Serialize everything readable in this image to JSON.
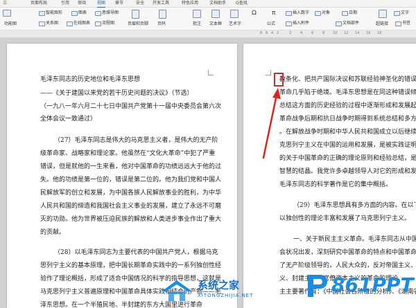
{
  "menu": {
    "tabs": [
      "三",
      "页面布局",
      "引用",
      "审阅",
      "视图",
      "章节",
      "安全",
      "开发工具",
      "特色应用",
      "文档助手",
      "Q查找"
    ],
    "active_index": 4
  },
  "ribbon": {
    "row1": [
      "智能图形",
      "图表",
      "思维导图",
      "插入数字",
      "对象",
      "日期",
      "文字"
    ],
    "row2": [
      "功能图",
      "关系图",
      "在线图表",
      "流程图",
      "页眉和页脚",
      "页码",
      "批注",
      "文本框",
      "艺术字",
      "公式",
      "插入附件",
      "文档部件",
      "超链接",
      "书签"
    ],
    "symbols": [
      "Ω",
      "π"
    ]
  },
  "ruler": {
    "numbers": [
      "8",
      "6",
      "4",
      "2",
      "2",
      "4",
      "6",
      "8",
      "10",
      "12",
      "14",
      "16",
      "18"
    ]
  },
  "left_page": {
    "lines": [
      "毛泽东同志的历史地位和毛泽东思想",
      "——《关于建国以来党的若干历史问题的决议》（节选）",
      "（一九八一年六月二十七日中国共产党第十一届中央委员会第六次",
      "全体会议一致通过）",
      "（27）毛泽东同志是伟大的马克思主义者，是伟大的无产阶",
      "级革命家、战略家和理论家。他虽然在“文化大革命”中犯了严重",
      "错误，但是就他的一生来看，他对中国革命的功绩远远大于他的过",
      "失。他的功绩是第一位的，错误是第二位的。他为我们党和中国人",
      "民解放军的创立和发展，为中国各族人民解放事业的胜利，为中华",
      "人民共和国的缔造和我国社会主义事业的发展，建立了永远不可磨",
      "灭的功勋。他为世界被压迫民族的解放和人类进步事业作出了重大",
      "的贡献。",
      "（28）以毛泽东同志为主要代表的中国共产党人，根据马克",
      "思列宁主义的基本原理，把中国长期革命实践中的一系列独创性经",
      "验作了理论概括，形成了适合中国情况的科学的指导思想，这就是",
      "马克思列宁主义普遍原理和中国革命具体实践相结合的产物——毛",
      "泽东思想。在一个半殖民地、半封建的东方大国里进行革命"
    ]
  },
  "right_page": {
    "lines": [
      "教条化、把共产国际决议和苏联经验神圣化的错误倾向",
      "革命几乎陷于绝境。毛泽东思想是在同这种错误倾向作",
      "总结这方面的历史经验的过程中逐渐形成和发展起来的",
      "革命战争后期和抗日战争时期得到系统总结和多方面展",
      "。在解放战争时期和中华人民共和国成立以后继续得到",
      "克思列宁主义在中国的运用和发展，是被实践证明了的",
      "的关于中国革命的正确的理论原则和经验总结，是中国",
      "智慧的结晶。我党许多卓越领导人对它的形成和发展都",
      "毛泽东同志的科学著作是它的集中概括。",
      "（29）毛泽东思想具有多方面的内容。在以下几",
      "以独创性的理论丰富和发展了马克思列宁主义。",
      "一、关于新民主主义革命。毛泽东同志从中国的历",
      "会状况出发，深刻研究中国革命的特点和中国革命的规",
      "了无产阶级领导的，人民大众的，反对帝国主义、封建",
      "义、封建主义和官僚资本主义的革命的理论",
      "主主要著作有：《中国社会各阶级的分析》、《湖南农民运"
    ]
  },
  "watermarks": {
    "left_brand": "系统之家",
    "left_url": "XITONGZHIJIA.NET",
    "right_brand": "861PPT"
  },
  "colors": {
    "annotation": "#e0231b",
    "active_tab": "#2b5fb6",
    "brand_blue": "#1a8de0"
  }
}
